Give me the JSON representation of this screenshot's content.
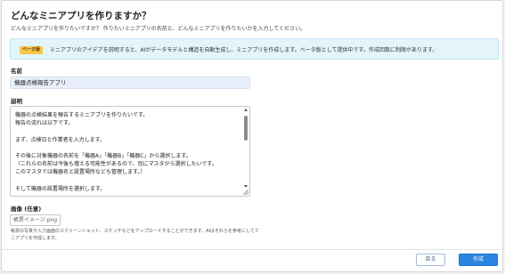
{
  "dialog": {
    "title": "どんなミニアプリを作りますか？",
    "subtitle": "どんなミニアプリを作りたいですか？ 作りたいミニアプリの名前と、どんなミニアプリを作りたいかを入力してください。"
  },
  "beta_notice": {
    "badge": "ベータ版",
    "text": "ミニアプリのアイデアを説明すると、AIがデータモデルと構造を自動生成し、ミニアプリを作成します。ベータ版として提供中です。作成回数に制限があります。"
  },
  "name_field": {
    "label": "名前",
    "value": "機器点検報告アプリ"
  },
  "description_field": {
    "label": "説明",
    "value": "機器の点検結果を報告するミニアプリを作りたいです。\n報告の流れは以下です。\n\nまず、点検日と作業者を入力します。\n\nその後に対象機器の名前を「機器A」「機器B」「機器C」から選択します。\n（これらの名前は今後も増える可能性があるので、別にマスタから選択したいです。\nこのマスタでは機器名と設置場所なども管理します。）\n\nそして機器の設置場所を選択します。"
  },
  "image_field": {
    "label": "画像 (任意)",
    "button_label": "帳票イメージ.png",
    "help_text": "帳票の写真や入力画面のスクリーンショット、スケッチなどをアップロードすることができます。AIはそれらを参考にしてミニアプリを作成します。"
  },
  "footer": {
    "back_label": "戻る",
    "create_label": "作成"
  },
  "colors": {
    "accent": "#2a84e0",
    "beta_badge": "#f7c64a",
    "beta_background": "#e3f5fb",
    "name_input_background": "#e8effa"
  }
}
